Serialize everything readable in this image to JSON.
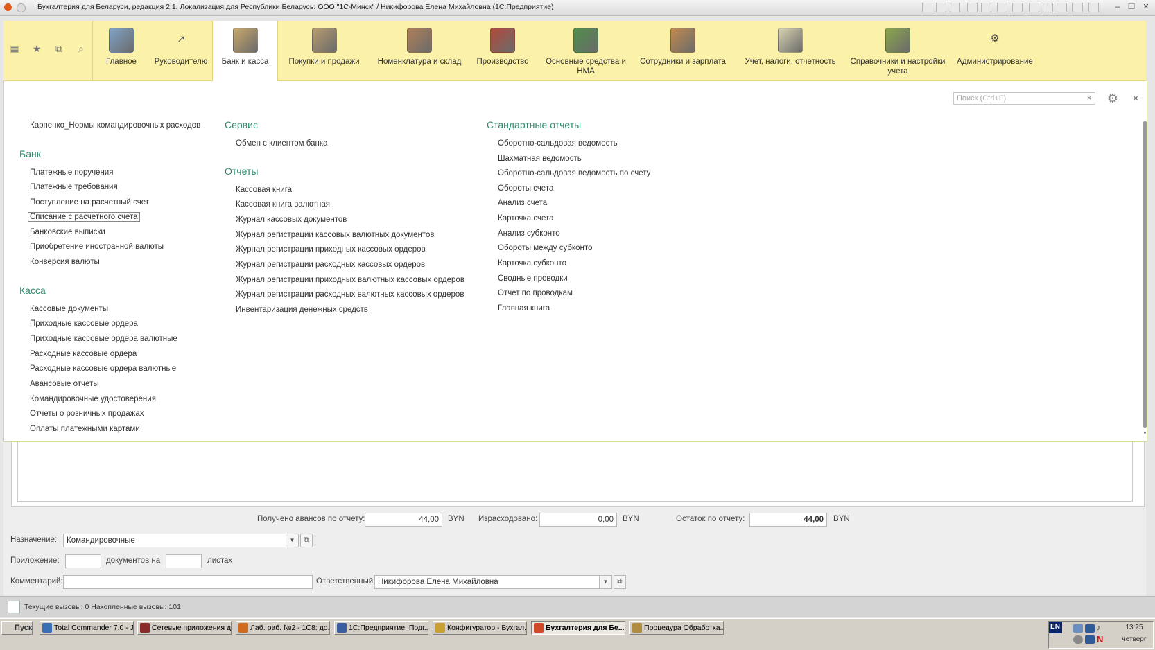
{
  "window": {
    "title": "Бухгалтерия для Беларуси, редакция 2.1. Локализация для Республики Беларусь: ООО \"1С-Минск\" / Никифорова Елена Михайловна (1С:Предприятие)"
  },
  "sections": [
    {
      "label": "Главное",
      "color": "#7fa3c9"
    },
    {
      "label": "Руководителю",
      "color": "#ffffff"
    },
    {
      "label": "Банк и касса",
      "color": "#c9a86a"
    },
    {
      "label": "Покупки и продажи",
      "color": "#b79b6e"
    },
    {
      "label": "Номенклатура и склад",
      "color": "#b08058"
    },
    {
      "label": "Производство",
      "color": "#b24a3a"
    },
    {
      "label": "Основные средства и НМА",
      "color": "#4f8f4a"
    },
    {
      "label": "Сотрудники и зарплата",
      "color": "#c28a4d"
    },
    {
      "label": "Учет, налоги, отчетность",
      "color": "#d9d3b0"
    },
    {
      "label": "Справочники и настройки учета",
      "color": "#8aa64a"
    },
    {
      "label": "Администрирование",
      "color": "#ffffff"
    }
  ],
  "search": {
    "placeholder": "Поиск (Ctrl+F)",
    "clear": "×"
  },
  "close_label": "×",
  "menu": {
    "top_item": "Карпенко_Нормы командировочных расходов",
    "bank": {
      "title": "Банк",
      "items": [
        "Платежные поручения",
        "Платежные требования",
        "Поступление на расчетный счет",
        "Списание с расчетного счета",
        "Банковские выписки",
        "Приобретение иностранной валюты",
        "Конверсия валюты"
      ]
    },
    "kassa": {
      "title": "Касса",
      "items": [
        "Кассовые документы",
        "Приходные кассовые ордера",
        "Приходные кассовые ордера валютные",
        "Расходные кассовые ордера",
        "Расходные кассовые ордера валютные",
        "Авансовые отчеты",
        "Командировочные удостоверения",
        "Отчеты о розничных продажах",
        "Оплаты платежными картами"
      ]
    },
    "service": {
      "title": "Сервис",
      "items": [
        "Обмен с клиентом банка"
      ]
    },
    "reports": {
      "title": "Отчеты",
      "items": [
        "Кассовая книга",
        "Кассовая книга валютная",
        "Журнал кассовых документов",
        "Журнал регистрации кассовых валютных документов",
        "Журнал регистрации приходных кассовых ордеров",
        "Журнал регистрации расходных кассовых ордеров",
        "Журнал регистрации приходных валютных кассовых ордеров",
        "Журнал регистрации расходных валютных кассовых ордеров",
        "Инвентаризация денежных средств"
      ]
    },
    "standard": {
      "title": "Стандартные отчеты",
      "items": [
        "Оборотно-сальдовая ведомость",
        "Шахматная ведомость",
        "Оборотно-сальдовая ведомость по счету",
        "Обороты счета",
        "Анализ счета",
        "Карточка счета",
        "Анализ субконто",
        "Обороты между субконто",
        "Карточка субконто",
        "Сводные проводки",
        "Отчет по проводкам",
        "Главная книга"
      ]
    }
  },
  "form": {
    "received_label": "Получено авансов по отчету:",
    "received_value": "44,00",
    "spent_label": "Израсходовано:",
    "spent_value": "0,00",
    "balance_label": "Остаток по отчету:",
    "balance_value": "44,00",
    "currency": "BYN",
    "purpose_label": "Назначение:",
    "purpose_value": "Командировочные",
    "attachment_label": "Приложение:",
    "attachment_docs": "",
    "docs_on_label": "документов на",
    "attachment_sheets": "",
    "sheets_label": "листах",
    "comment_label": "Комментарий:",
    "comment_value": "",
    "responsible_label": "Ответственный:",
    "responsible_value": "Никифорова Елена Михайловна"
  },
  "status": {
    "text": "Текущие вызовы: 0   Накопленные вызовы: 101"
  },
  "taskbar": {
    "start": "Пуск",
    "buttons": [
      {
        "label": "Total Commander 7.0 - J...",
        "color": "#3a6fb5"
      },
      {
        "label": "Сетевые приложения д...",
        "color": "#8a2b2b"
      },
      {
        "label": "Лаб. раб. №2 - 1С8: до...",
        "color": "#d06a1e"
      },
      {
        "label": "1С:Предприятие. Подг...",
        "color": "#3a5fa0"
      },
      {
        "label": "Конфигуратор - Бухгал...",
        "color": "#c9a030"
      },
      {
        "label": "Бухгалтерия для Бе...",
        "color": "#d04a2a"
      },
      {
        "label": "Процедура Обработка...",
        "color": "#b08c40"
      }
    ],
    "lang": "EN",
    "time": "13:25",
    "day": "четверг"
  }
}
